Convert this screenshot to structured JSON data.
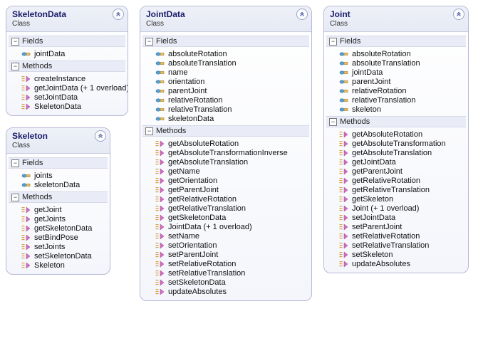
{
  "classes": {
    "skeletonData": {
      "title": "SkeletonData",
      "subtitle": "Class",
      "sections": {
        "fields": {
          "label": "Fields",
          "items": [
            "jointData"
          ]
        },
        "methods": {
          "label": "Methods",
          "items": [
            "createInstance",
            "getJointData (+ 1 overload)",
            "setJointData",
            "SkeletonData"
          ]
        }
      }
    },
    "skeleton": {
      "title": "Skeleton",
      "subtitle": "Class",
      "sections": {
        "fields": {
          "label": "Fields",
          "items": [
            "joints",
            "skeletonData"
          ]
        },
        "methods": {
          "label": "Methods",
          "items": [
            "getJoint",
            "getJoints",
            "getSkeletonData",
            "setBindPose",
            "setJoints",
            "setSkeletonData",
            "Skeleton"
          ]
        }
      }
    },
    "jointData": {
      "title": "JointData",
      "subtitle": "Class",
      "sections": {
        "fields": {
          "label": "Fields",
          "items": [
            "absoluteRotation",
            "absoluteTranslation",
            "name",
            "orientation",
            "parentJoint",
            "relativeRotation",
            "relativeTranslation",
            "skeletonData"
          ]
        },
        "methods": {
          "label": "Methods",
          "items": [
            "getAbsoluteRotation",
            "getAbsoluteTransformationInverse",
            "getAbsoluteTranslation",
            "getName",
            "getOrientation",
            "getParentJoint",
            "getRelativeRotation",
            "getRelativeTranslation",
            "getSkeletonData",
            "JointData (+ 1 overload)",
            "setName",
            "setOrientation",
            "setParentJoint",
            "setRelativeRotation",
            "setRelativeTranslation",
            "setSkeletonData",
            "updateAbsolutes"
          ]
        }
      }
    },
    "joint": {
      "title": "Joint",
      "subtitle": "Class",
      "sections": {
        "fields": {
          "label": "Fields",
          "items": [
            "absoluteRotation",
            "absoluteTranslation",
            "jointData",
            "parentJoint",
            "relativeRotation",
            "relativeTranslation",
            "skeleton"
          ]
        },
        "methods": {
          "label": "Methods",
          "items": [
            "getAbsoluteRotation",
            "getAbsoluteTransformation",
            "getAbsoluteTranslation",
            "getJointData",
            "getParentJoint",
            "getRelativeRotation",
            "getRelativeTranslation",
            "getSkeleton",
            "Joint (+ 1 overload)",
            "setJointData",
            "setParentJoint",
            "setRelativeRotation",
            "setRelativeTranslation",
            "setSkeleton",
            "updateAbsolutes"
          ]
        }
      }
    }
  }
}
